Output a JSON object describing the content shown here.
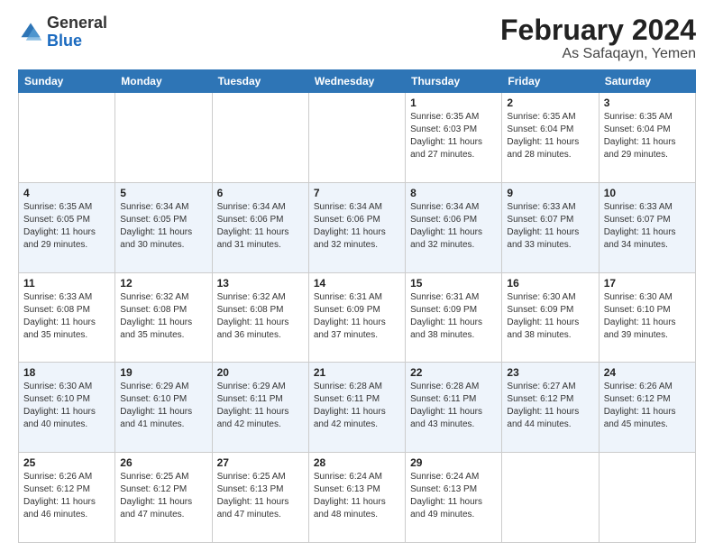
{
  "header": {
    "logo_general": "General",
    "logo_blue": "Blue",
    "month_title": "February 2024",
    "location": "As Safaqayn, Yemen"
  },
  "days_of_week": [
    "Sunday",
    "Monday",
    "Tuesday",
    "Wednesday",
    "Thursday",
    "Friday",
    "Saturday"
  ],
  "weeks": [
    [
      {
        "day": "",
        "info": ""
      },
      {
        "day": "",
        "info": ""
      },
      {
        "day": "",
        "info": ""
      },
      {
        "day": "",
        "info": ""
      },
      {
        "day": "1",
        "info": "Sunrise: 6:35 AM\nSunset: 6:03 PM\nDaylight: 11 hours and 27 minutes."
      },
      {
        "day": "2",
        "info": "Sunrise: 6:35 AM\nSunset: 6:04 PM\nDaylight: 11 hours and 28 minutes."
      },
      {
        "day": "3",
        "info": "Sunrise: 6:35 AM\nSunset: 6:04 PM\nDaylight: 11 hours and 29 minutes."
      }
    ],
    [
      {
        "day": "4",
        "info": "Sunrise: 6:35 AM\nSunset: 6:05 PM\nDaylight: 11 hours and 29 minutes."
      },
      {
        "day": "5",
        "info": "Sunrise: 6:34 AM\nSunset: 6:05 PM\nDaylight: 11 hours and 30 minutes."
      },
      {
        "day": "6",
        "info": "Sunrise: 6:34 AM\nSunset: 6:06 PM\nDaylight: 11 hours and 31 minutes."
      },
      {
        "day": "7",
        "info": "Sunrise: 6:34 AM\nSunset: 6:06 PM\nDaylight: 11 hours and 32 minutes."
      },
      {
        "day": "8",
        "info": "Sunrise: 6:34 AM\nSunset: 6:06 PM\nDaylight: 11 hours and 32 minutes."
      },
      {
        "day": "9",
        "info": "Sunrise: 6:33 AM\nSunset: 6:07 PM\nDaylight: 11 hours and 33 minutes."
      },
      {
        "day": "10",
        "info": "Sunrise: 6:33 AM\nSunset: 6:07 PM\nDaylight: 11 hours and 34 minutes."
      }
    ],
    [
      {
        "day": "11",
        "info": "Sunrise: 6:33 AM\nSunset: 6:08 PM\nDaylight: 11 hours and 35 minutes."
      },
      {
        "day": "12",
        "info": "Sunrise: 6:32 AM\nSunset: 6:08 PM\nDaylight: 11 hours and 35 minutes."
      },
      {
        "day": "13",
        "info": "Sunrise: 6:32 AM\nSunset: 6:08 PM\nDaylight: 11 hours and 36 minutes."
      },
      {
        "day": "14",
        "info": "Sunrise: 6:31 AM\nSunset: 6:09 PM\nDaylight: 11 hours and 37 minutes."
      },
      {
        "day": "15",
        "info": "Sunrise: 6:31 AM\nSunset: 6:09 PM\nDaylight: 11 hours and 38 minutes."
      },
      {
        "day": "16",
        "info": "Sunrise: 6:30 AM\nSunset: 6:09 PM\nDaylight: 11 hours and 38 minutes."
      },
      {
        "day": "17",
        "info": "Sunrise: 6:30 AM\nSunset: 6:10 PM\nDaylight: 11 hours and 39 minutes."
      }
    ],
    [
      {
        "day": "18",
        "info": "Sunrise: 6:30 AM\nSunset: 6:10 PM\nDaylight: 11 hours and 40 minutes."
      },
      {
        "day": "19",
        "info": "Sunrise: 6:29 AM\nSunset: 6:10 PM\nDaylight: 11 hours and 41 minutes."
      },
      {
        "day": "20",
        "info": "Sunrise: 6:29 AM\nSunset: 6:11 PM\nDaylight: 11 hours and 42 minutes."
      },
      {
        "day": "21",
        "info": "Sunrise: 6:28 AM\nSunset: 6:11 PM\nDaylight: 11 hours and 42 minutes."
      },
      {
        "day": "22",
        "info": "Sunrise: 6:28 AM\nSunset: 6:11 PM\nDaylight: 11 hours and 43 minutes."
      },
      {
        "day": "23",
        "info": "Sunrise: 6:27 AM\nSunset: 6:12 PM\nDaylight: 11 hours and 44 minutes."
      },
      {
        "day": "24",
        "info": "Sunrise: 6:26 AM\nSunset: 6:12 PM\nDaylight: 11 hours and 45 minutes."
      }
    ],
    [
      {
        "day": "25",
        "info": "Sunrise: 6:26 AM\nSunset: 6:12 PM\nDaylight: 11 hours and 46 minutes."
      },
      {
        "day": "26",
        "info": "Sunrise: 6:25 AM\nSunset: 6:12 PM\nDaylight: 11 hours and 47 minutes."
      },
      {
        "day": "27",
        "info": "Sunrise: 6:25 AM\nSunset: 6:13 PM\nDaylight: 11 hours and 47 minutes."
      },
      {
        "day": "28",
        "info": "Sunrise: 6:24 AM\nSunset: 6:13 PM\nDaylight: 11 hours and 48 minutes."
      },
      {
        "day": "29",
        "info": "Sunrise: 6:24 AM\nSunset: 6:13 PM\nDaylight: 11 hours and 49 minutes."
      },
      {
        "day": "",
        "info": ""
      },
      {
        "day": "",
        "info": ""
      }
    ]
  ]
}
